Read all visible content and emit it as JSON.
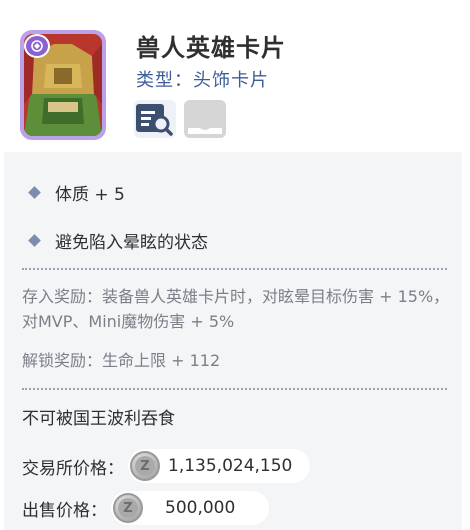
{
  "item": {
    "name": "兽人英雄卡片",
    "type_label": "类型：头饰卡片",
    "icons": {
      "card": "orc-hero-card-icon",
      "details": "details-search-icon",
      "wardrobe": "wardrobe-icon"
    }
  },
  "stats": [
    {
      "text": "体质 + 5"
    },
    {
      "text": "避免陷入晕眩的状态"
    }
  ],
  "rewards": {
    "deposit": "存入奖励：装备兽人英雄卡片时，对眩晕目标伤害 + 15%，对MVP、Mini魔物伤害 + 5%",
    "unlock": "解锁奖励：生命上限 + 112"
  },
  "note": "不可被国王波利吞食",
  "prices": {
    "exchange_label": "交易所价格：",
    "exchange_value": "1,135,024,150",
    "sell_label": "出售价格：",
    "sell_value": "500,000",
    "coin_icon": "zeny-coin-icon",
    "coin_glyph": "Z"
  },
  "colors": {
    "panel_bg": "#f4f5f7",
    "subtitle": "#3e5d98",
    "card_frame": "#bba0ea"
  }
}
